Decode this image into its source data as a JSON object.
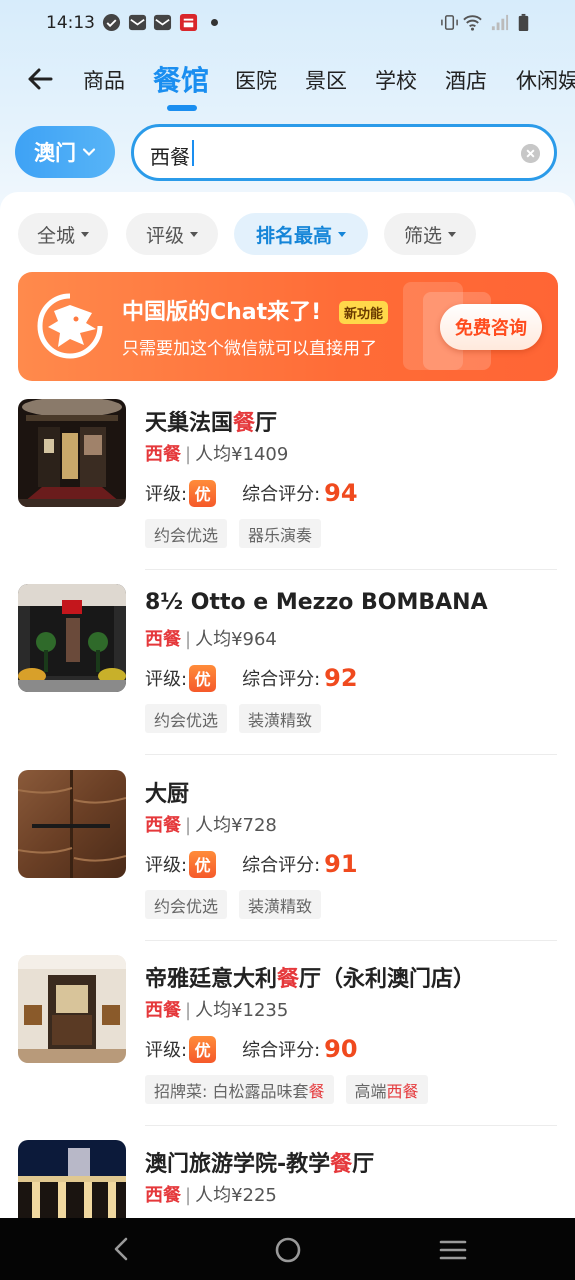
{
  "status_bar": {
    "time": "14:13"
  },
  "tabs": [
    {
      "label": "商品",
      "active": false
    },
    {
      "label": "餐馆",
      "active": true
    },
    {
      "label": "医院",
      "active": false
    },
    {
      "label": "景区",
      "active": false
    },
    {
      "label": "学校",
      "active": false
    },
    {
      "label": "酒店",
      "active": false
    },
    {
      "label": "休闲娱",
      "active": false
    }
  ],
  "search": {
    "city": "澳门",
    "query": "西餐"
  },
  "filters": [
    {
      "label": "全城",
      "active": false
    },
    {
      "label": "评级",
      "active": false
    },
    {
      "label": "排名最高",
      "active": true
    },
    {
      "label": "筛选",
      "active": false
    }
  ],
  "banner": {
    "title": "中国版的Chat来了!",
    "badge": "新功能",
    "subtitle": "只需要加这个微信就可以直接用了",
    "button": "免费咨询"
  },
  "rating_label": "评级:",
  "rating_badge": "优",
  "score_label": "综合评分:",
  "restaurants": [
    {
      "name_before": "天巢法国",
      "name_hl": "餐",
      "name_after": "厅",
      "category": "西餐",
      "avg_price": "人均¥1409",
      "score": "94",
      "tags": [
        "约会优选",
        "器乐演奏"
      ]
    },
    {
      "name_before": "8½ Otto e Mezzo BOMBANA",
      "name_hl": "",
      "name_after": "",
      "category": "西餐",
      "avg_price": "人均¥964",
      "score": "92",
      "tags": [
        "约会优选",
        "装潢精致"
      ]
    },
    {
      "name_before": "大厨",
      "name_hl": "",
      "name_after": "",
      "category": "西餐",
      "avg_price": "人均¥728",
      "score": "91",
      "tags": [
        "约会优选",
        "装潢精致"
      ]
    },
    {
      "name_before": "帝雅廷意大利",
      "name_hl": "餐",
      "name_after": "厅（永利澳门店）",
      "category": "西餐",
      "avg_price": "人均¥1235",
      "score": "90",
      "tag_dish_before": "招牌菜: 白松露品味套",
      "tag_dish_hl": "餐",
      "tag_high_before": "高端",
      "tag_high_hl": "西餐"
    },
    {
      "name_before": "澳门旅游学院-教学",
      "name_hl": "餐",
      "name_after": "厅",
      "category": "西餐",
      "avg_price": "人均¥225"
    }
  ]
}
